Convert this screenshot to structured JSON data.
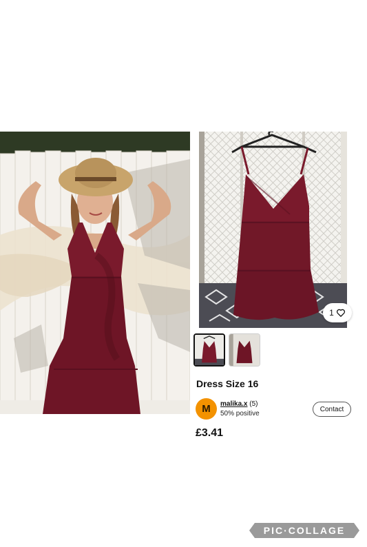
{
  "listing": {
    "title": "Dress Size 16",
    "price": "£3.41",
    "likes": "1"
  },
  "seller": {
    "avatar_letter": "M",
    "username": "malika.x",
    "rating_count": "(5)",
    "feedback": "50% positive"
  },
  "actions": {
    "contact_label": "Contact"
  },
  "watermark": {
    "text": "PIC·COLLAGE"
  },
  "colors": {
    "dress": "#7a1a2c",
    "avatar": "#f39200"
  },
  "icons": {
    "like": "heart-icon"
  }
}
